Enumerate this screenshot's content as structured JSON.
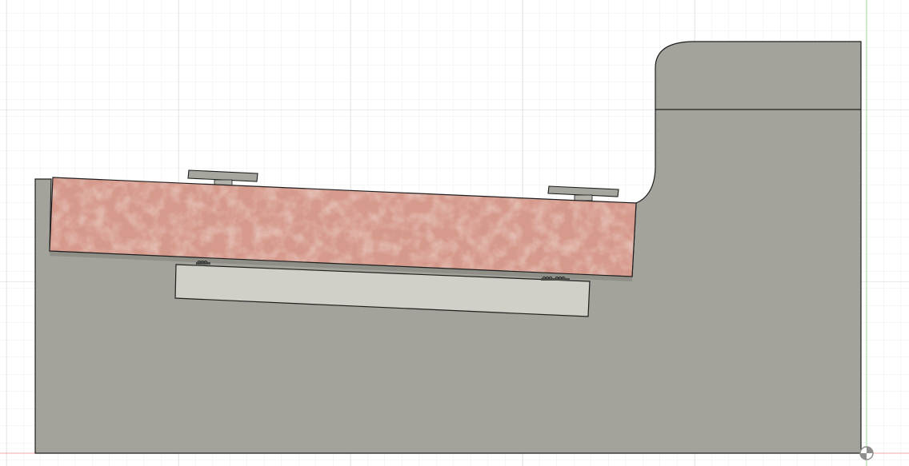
{
  "viewport": {
    "grid": {
      "visible": true,
      "minor_color": "#ececec",
      "major_color": "#d4d4d4"
    },
    "axes": {
      "x_color": "#f2a8a8",
      "y_color": "#9fd89f"
    }
  },
  "model": {
    "colors": {
      "body_fill": "#a3a39b",
      "outline": "#1e1e1e",
      "slab_fill": "#d69a8c",
      "slab_speckle": "#c47f70",
      "plate_fill": "#d0d0c8",
      "clip_fill": "#a6a69e"
    },
    "parts": [
      "housing-body",
      "textured-slab",
      "lower-plate",
      "clip-left",
      "clip-right",
      "spring-left",
      "spring-right"
    ]
  },
  "origin_marker": {
    "icon": "origin-circle-icon"
  }
}
